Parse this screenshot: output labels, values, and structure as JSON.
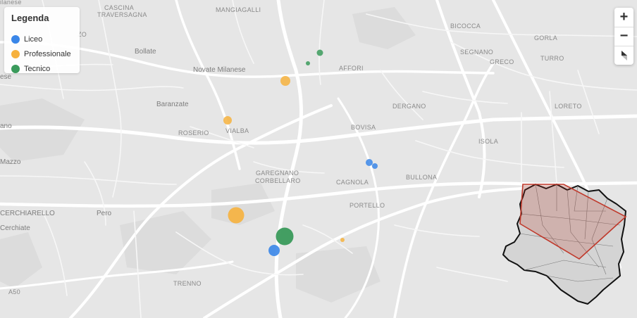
{
  "legend": {
    "title": "Legenda",
    "items": [
      {
        "label": "Liceo",
        "color": "#3a86e8"
      },
      {
        "label": "Professionale",
        "color": "#f6b13d"
      },
      {
        "label": "Tecnico",
        "color": "#3a9a5b"
      }
    ]
  },
  "controls": {
    "zoom_in": "+",
    "zoom_out": "−",
    "reset_icon": "north-arrow-icon"
  },
  "places": {
    "cascina_1": "CASCINA",
    "cascina_2": "TRAVERSAGNA",
    "mangiagalli": "MANGIAGALLI",
    "bicocca": "BICOCCA",
    "gorla": "GORLA",
    "segnano": "SEGNANO",
    "turro": "TURRO",
    "greco": "GRECO",
    "bollate": "Bollate",
    "novate": "Novate Milanese",
    "affori": "AFFORI",
    "baranzate": "Baranzate",
    "dergano": "DERGANO",
    "loreto": "LORETO",
    "roserio": "ROSERIO",
    "vialba": "VIALBA",
    "bovisa": "BOVISA",
    "isola": "ISOLA",
    "garegnano_1": "GAREGNANO",
    "garegnano_2": "CORBELLARO",
    "cagnola": "CAGNOLA",
    "bullona": "BULLONA",
    "pero": "Pero",
    "portello": "PORTELLO",
    "trenno": "TRENNO",
    "cerchiarello": "CERCHIARELLO",
    "cerchiate": "Cerchiate",
    "mazzo": "Mazzo",
    "edge_1": "ilanese",
    "edge_2": "ese",
    "edge_3": "ano",
    "edge_4": "ZO",
    "edge_5": "A50"
  },
  "schools": [
    {
      "type": "Tecnico",
      "color": "#3a9a5b",
      "size": "small"
    },
    {
      "type": "Tecnico",
      "color": "#3a9a5b",
      "size": "tiny"
    },
    {
      "type": "Professionale",
      "color": "#f6b13d",
      "size": "small"
    },
    {
      "type": "Professionale",
      "color": "#f6b13d",
      "size": "small"
    },
    {
      "type": "Liceo",
      "color": "#3a86e8",
      "size": "tiny"
    },
    {
      "type": "Liceo",
      "color": "#3a86e8",
      "size": "tiny"
    },
    {
      "type": "Professionale",
      "color": "#f6b13d",
      "size": "large"
    },
    {
      "type": "Tecnico",
      "color": "#3a9a5b",
      "size": "large"
    },
    {
      "type": "Liceo",
      "color": "#3a86e8",
      "size": "medium"
    },
    {
      "type": "Professionale",
      "color": "#f6b13d",
      "size": "tiny"
    }
  ],
  "minimap": {
    "boundary_color": "#111111",
    "extent_color": "#c0392b"
  }
}
